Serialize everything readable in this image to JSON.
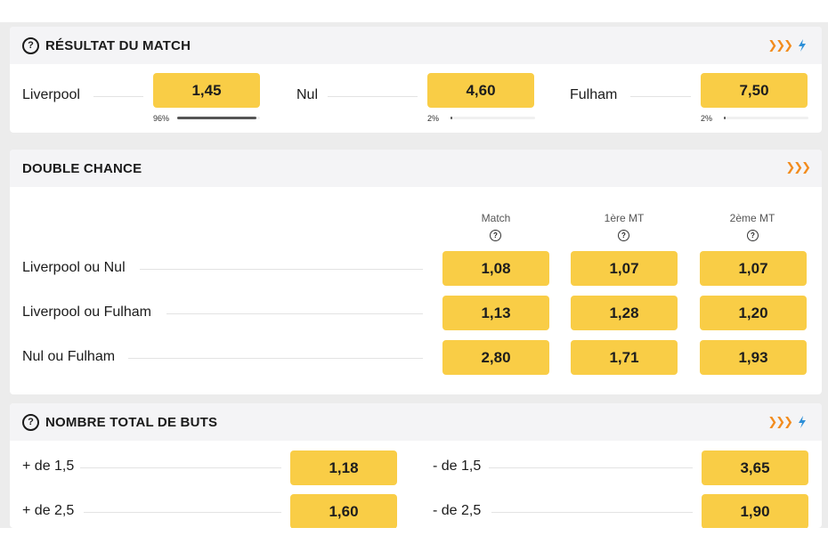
{
  "result_match": {
    "title": "RÉSULTAT DU MATCH",
    "help_icon": "?",
    "outcomes": [
      {
        "label": "Liverpool",
        "odd": "1,45",
        "pct_text": "96%",
        "pct": 0.96
      },
      {
        "label": "Nul",
        "odd": "4,60",
        "pct_text": "2%",
        "pct": 0.02
      },
      {
        "label": "Fulham",
        "odd": "7,50",
        "pct_text": "2%",
        "pct": 0.02
      }
    ]
  },
  "double_chance": {
    "title": "DOUBLE CHANCE",
    "columns": [
      {
        "label": "Match",
        "help": "?"
      },
      {
        "label": "1ère MT",
        "help": "?"
      },
      {
        "label": "2ème MT",
        "help": "?"
      }
    ],
    "rows": [
      {
        "label": "Liverpool ou Nul",
        "odds": [
          "1,08",
          "1,07",
          "1,07"
        ]
      },
      {
        "label": "Liverpool ou Fulham",
        "odds": [
          "1,13",
          "1,28",
          "1,20"
        ]
      },
      {
        "label": "Nul ou Fulham",
        "odds": [
          "2,80",
          "1,71",
          "1,93"
        ]
      }
    ]
  },
  "total_goals": {
    "title": "NOMBRE TOTAL DE BUTS",
    "help_icon": "?",
    "rows": [
      {
        "over_label": "+ de 1,5",
        "over_odd": "1,18",
        "under_label": "- de 1,5",
        "under_odd": "3,65"
      },
      {
        "over_label": "+ de 2,5",
        "over_odd": "1,60",
        "under_label": "- de 2,5",
        "under_odd": "1,90"
      }
    ]
  },
  "icons": {
    "boost": "boost-icon",
    "live": "live-icon"
  },
  "colors": {
    "odd_button": "#f9cd46",
    "boost": "#f28c1e",
    "live": "#2d8fd8",
    "header_bg": "#f4f4f6"
  }
}
